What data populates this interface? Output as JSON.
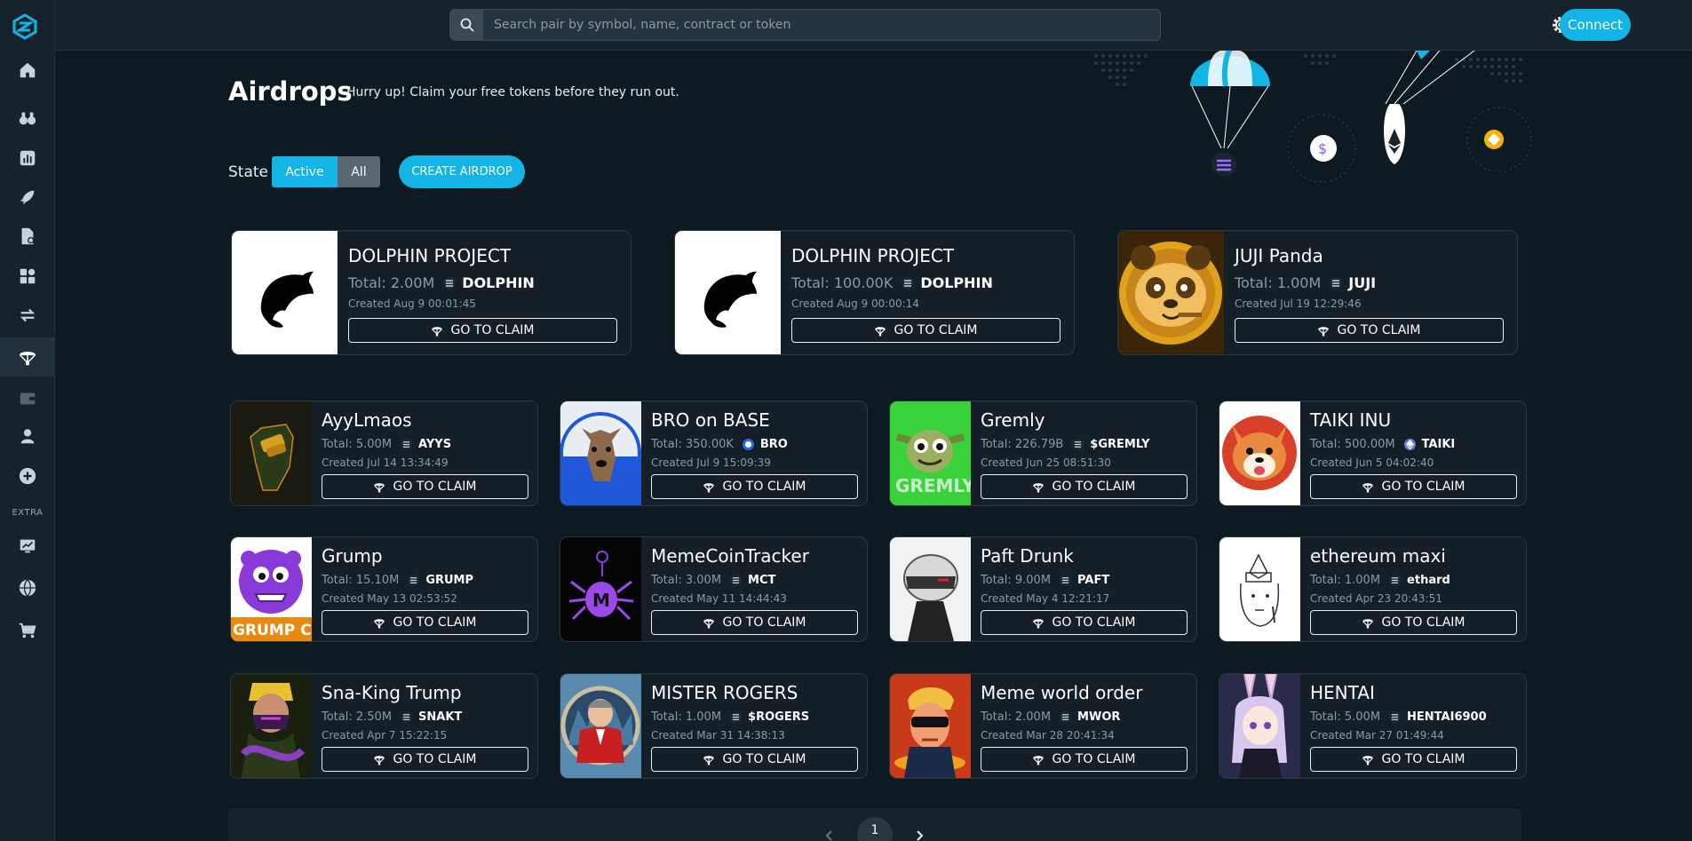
{
  "search": {
    "placeholder": "Search pair by symbol, name, contract or token"
  },
  "sidebar": {
    "extra_label": "EXTRA",
    "items": [
      {
        "icon": "home-icon"
      },
      {
        "icon": "binoculars-icon"
      },
      {
        "icon": "chart-icon"
      },
      {
        "icon": "rocket-icon"
      },
      {
        "icon": "document-icon"
      },
      {
        "icon": "apps-icon"
      },
      {
        "icon": "swap-icon"
      },
      {
        "icon": "airdrop-icon",
        "active": true
      },
      {
        "icon": "wallet-icon"
      },
      {
        "icon": "user-icon"
      },
      {
        "icon": "plus-icon"
      },
      {
        "icon": "monitor-chart-icon"
      },
      {
        "icon": "globe-icon"
      },
      {
        "icon": "cart-icon"
      }
    ]
  },
  "topbar": {
    "connect_label": "Connect"
  },
  "header": {
    "title": "Airdrops",
    "subtitle": "Hurry up! Claim your free tokens before they run out.",
    "state_label": "State",
    "state_active": "Active",
    "state_all": "All",
    "create_label": "CREATE AIRDROP"
  },
  "claim_label": "GO TO CLAIM",
  "featured": [
    {
      "name": "DOLPHIN PROJECT",
      "total": "Total: 2.00M",
      "symbol": "DOLPHIN",
      "created": "Created Aug 9 00:01:45",
      "thumb": "dolphin"
    },
    {
      "name": "DOLPHIN PROJECT",
      "total": "Total: 100.00K",
      "symbol": "DOLPHIN",
      "created": "Created Aug 9 00:00:14",
      "thumb": "dolphin"
    },
    {
      "name": "JUJI Panda",
      "total": "Total: 1.00M",
      "symbol": "JUJI",
      "created": "Created Jul 19 12:29:46",
      "thumb": "panda"
    }
  ],
  "airdrops": [
    {
      "name": "AyyLmaos",
      "total": "Total: 5.00M",
      "symbol": "AYYS",
      "created": "Created Jul 14 13:34:49",
      "thumb": "ayyl",
      "chain": "sol"
    },
    {
      "name": "BRO on BASE",
      "total": "Total: 350.00K",
      "symbol": "BRO",
      "created": "Created Jul 9 15:09:39",
      "thumb": "bro",
      "chain": "base"
    },
    {
      "name": "Gremly",
      "total": "Total: 226.79B",
      "symbol": "$GREMLY",
      "created": "Created Jun 25 08:51:30",
      "thumb": "gremly",
      "chain": "sol"
    },
    {
      "name": "TAIKI INU",
      "total": "Total: 500.00M",
      "symbol": "TAIKI",
      "created": "Created Jun 5 04:02:40",
      "thumb": "taiki",
      "chain": "eth"
    },
    {
      "name": "Grump",
      "total": "Total: 15.10M",
      "symbol": "GRUMP",
      "created": "Created May 13 02:53:52",
      "thumb": "grump",
      "chain": "sol"
    },
    {
      "name": "MemeCoinTracker",
      "total": "Total: 3.00M",
      "symbol": "MCT",
      "created": "Created May 11 14:44:43",
      "thumb": "mct",
      "chain": "sol"
    },
    {
      "name": "Paft Drunk",
      "total": "Total: 9.00M",
      "symbol": "PAFT",
      "created": "Created May 4 12:21:17",
      "thumb": "paft",
      "chain": "sol"
    },
    {
      "name": "ethereum maxi",
      "total": "Total: 1.00M",
      "symbol": "ethard",
      "created": "Created Apr 23 20:43:51",
      "thumb": "ethmaxi",
      "chain": "sol"
    },
    {
      "name": "Sna-King Trump",
      "total": "Total: 2.50M",
      "symbol": "SNAKT",
      "created": "Created Apr 7 15:22:15",
      "thumb": "snaking",
      "chain": "sol"
    },
    {
      "name": "MISTER ROGERS",
      "total": "Total: 1.00M",
      "symbol": "$ROGERS",
      "created": "Created Mar 31 14:38:13",
      "thumb": "rogers",
      "chain": "sol"
    },
    {
      "name": "Meme world order",
      "total": "Total: 2.00M",
      "symbol": "MWOR",
      "created": "Created Mar 28 20:41:34",
      "thumb": "mwor",
      "chain": "sol"
    },
    {
      "name": "HENTAI",
      "total": "Total: 5.00M",
      "symbol": "HENTAI6900",
      "created": "Created Mar 27 01:49:44",
      "thumb": "hentai",
      "chain": "sol"
    }
  ],
  "pagination": {
    "current": "1"
  },
  "colors": {
    "accent": "#13b4e6",
    "background": "#0e1a22",
    "card": "#141f27"
  }
}
